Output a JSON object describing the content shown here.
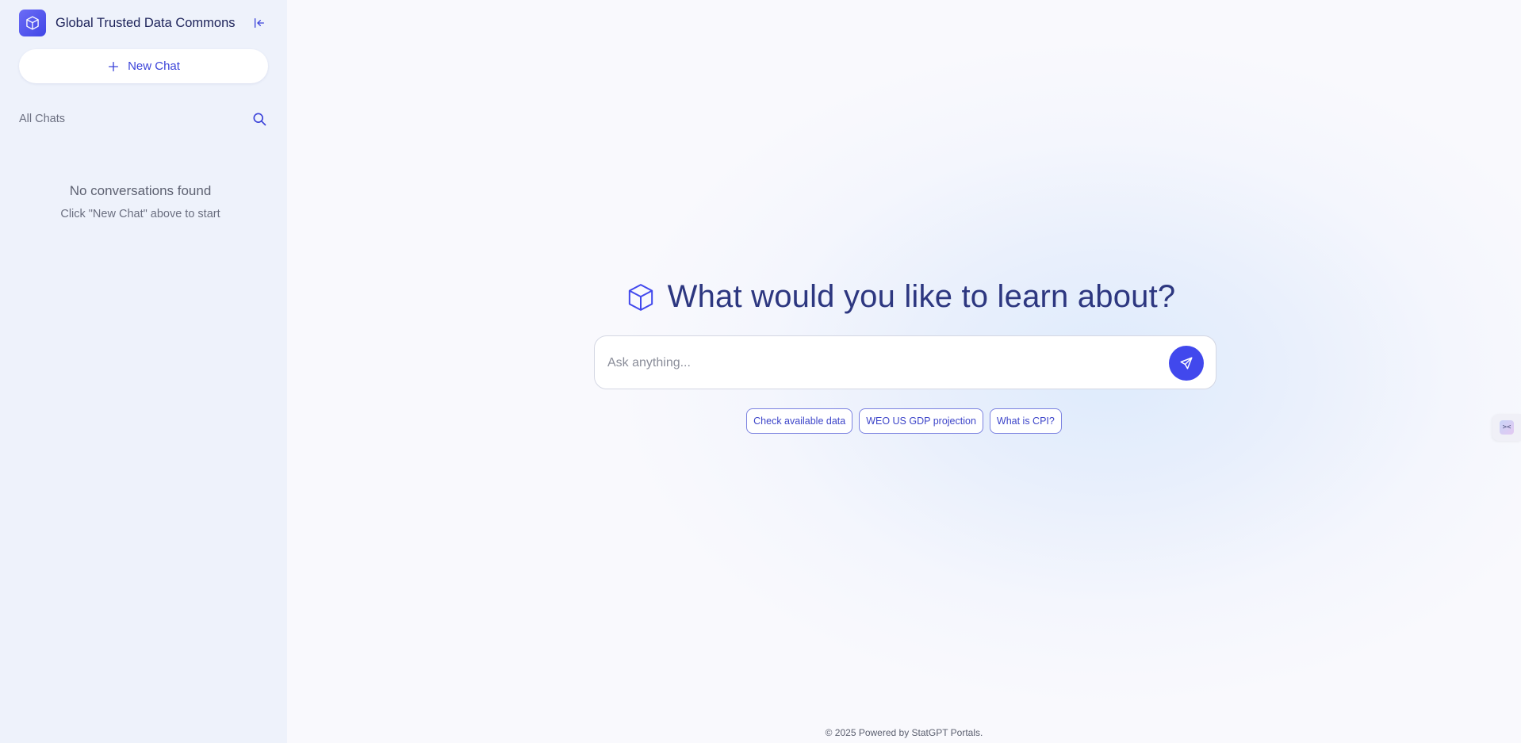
{
  "sidebar": {
    "app_title": "Global Trusted Data Commons",
    "new_chat_label": "New Chat",
    "all_chats_label": "All Chats",
    "empty_title": "No conversations found",
    "empty_subtitle": "Click \"New Chat\" above to start",
    "icons": [
      "cube-icon",
      "collapse-sidebar-icon",
      "plus-icon",
      "search-icon"
    ]
  },
  "main": {
    "hero_title": "What would you like to learn about?",
    "input_placeholder": "Ask anything...",
    "input_value": "",
    "suggestions": [
      "Check available data",
      "WEO US GDP projection",
      "What is CPI?"
    ],
    "footer": "© 2025 Powered by StatGPT Portals.",
    "side_widget_text": "><"
  },
  "colors": {
    "accent": "#4148ed",
    "sidebar_bg": "#eef2fb",
    "title": "#2d3780"
  }
}
